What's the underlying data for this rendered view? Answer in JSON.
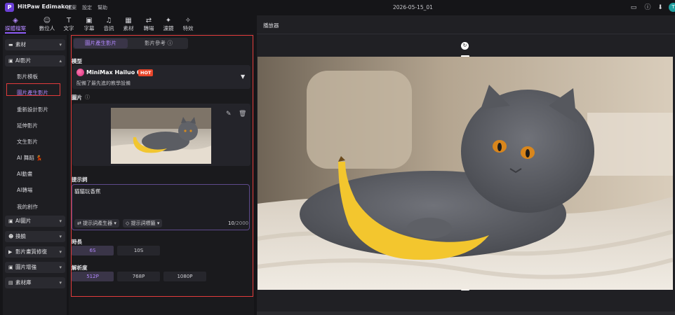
{
  "app": {
    "logo_letter": "P",
    "name": "HitPaw Edimakor",
    "menus": [
      "檔案",
      "設定",
      "幫助"
    ],
    "document_title": "2026-05-15_01",
    "avatar_letter": "T"
  },
  "toolbar": {
    "items": [
      {
        "label": "媒體檔案",
        "icon": "media-icon",
        "glyph": "◈"
      },
      {
        "label": "數位人",
        "icon": "digital-human-icon",
        "glyph": "☺"
      },
      {
        "label": "文字",
        "icon": "text-icon",
        "glyph": "T"
      },
      {
        "label": "字幕",
        "icon": "subtitle-icon",
        "glyph": "▣"
      },
      {
        "label": "音訊",
        "icon": "audio-icon",
        "glyph": "♫"
      },
      {
        "label": "素材",
        "icon": "assets-icon",
        "glyph": "▦"
      },
      {
        "label": "轉場",
        "icon": "transition-icon",
        "glyph": "⇄"
      },
      {
        "label": "濾鏡",
        "icon": "filter-icon",
        "glyph": "✦"
      },
      {
        "label": "特效",
        "icon": "effects-icon",
        "glyph": "✧"
      }
    ]
  },
  "sidebar": {
    "groups": {
      "assets": "素材",
      "ai_video": "AI影片",
      "ai_image": "AI圖片",
      "face_swap": "換臉",
      "video_repair": "影片畫質修復",
      "image_enhance": "圖片增強",
      "library": "素材庫"
    },
    "ai_video_items": [
      "影片模板",
      "圖片產生影片",
      "重新設計影片",
      "延伸影片",
      "文生影片",
      "AI 舞蹈",
      "AI動畫",
      "AI轉場",
      "我的創作"
    ],
    "dance_emoji": "💃"
  },
  "panel": {
    "tabs": [
      "圖片產生影片",
      "影片參考"
    ],
    "model_label": "模型",
    "model_name": "MiniMax Hailuo 02",
    "hot_badge": "HOT",
    "model_description": "配備了最先進的教學設備",
    "image_label": "圖片",
    "prompt_label": "提示詞",
    "prompt_text": "貓貓玩香蕉",
    "prompt_generator": "提示詞產生器",
    "prompt_tags": "提示詞標籤",
    "char_count": "10",
    "char_limit": "/2000",
    "duration_label": "時長",
    "duration_options": [
      "6S",
      "10S"
    ],
    "duration_selected": "6S",
    "resolution_label": "解析度",
    "resolution_options": [
      "512P",
      "768P",
      "1080P"
    ],
    "resolution_selected": "512P"
  },
  "player": {
    "title": "播放器"
  },
  "colors": {
    "accent": "#8e5cf7",
    "accent_text": "#b388ff",
    "highlight_border": "#e23b3b",
    "hot_badge": "#e8452a",
    "background": "#151518"
  }
}
